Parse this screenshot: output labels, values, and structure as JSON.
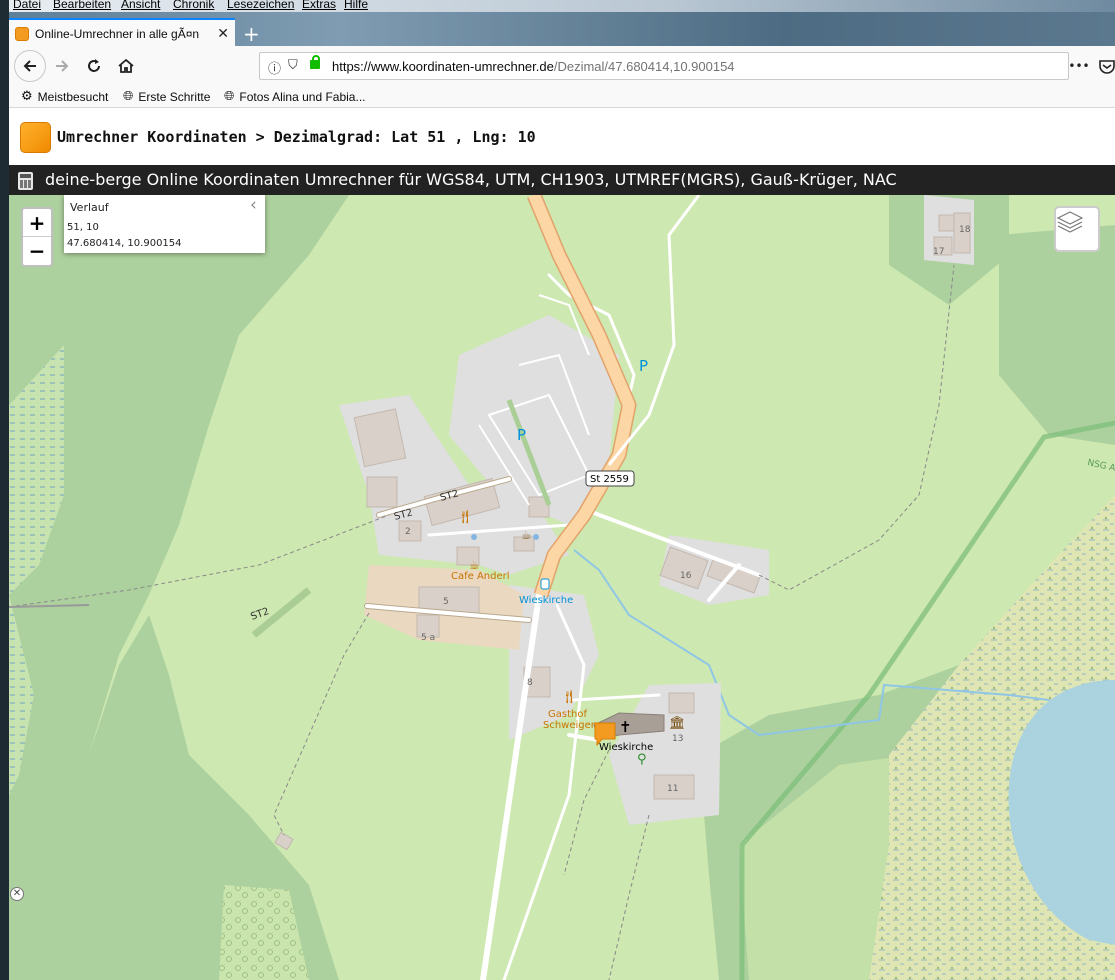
{
  "menu": [
    "Datei",
    "Bearbeiten",
    "Ansicht",
    "Chronik",
    "Lesezeichen",
    "Extras",
    "Hilfe"
  ],
  "tab": {
    "title": "Online-Umrechner in alle gÃ¤n",
    "close": "✕"
  },
  "newtab": "+",
  "nav": {
    "url_domain": "https://www.koordinaten-umrechner.de",
    "url_path": "/Dezimal/47.680414,10.900154",
    "more": "•••"
  },
  "bookmarks": [
    {
      "label": "Meistbesucht",
      "icon": "gear-icon"
    },
    {
      "label": "Erste Schritte",
      "icon": "globe-icon"
    },
    {
      "label": "Fotos Alina und Fabia...",
      "icon": "globe-icon"
    }
  ],
  "page": {
    "heading": "Umrechner Koordinaten > Dezimalgrad: Lat 51 , Lng: 10",
    "banner": "deine-berge Online Koordinaten Umrechner für WGS84, UTM, CH1903, UTMREF(MGRS), Gauß-Krüger, NAC"
  },
  "map": {
    "zoom_in": "+",
    "zoom_out": "−",
    "history": {
      "title": "Verlauf",
      "entries": [
        "51, 10",
        "47.680414, 10.900154"
      ]
    },
    "labels": {
      "road": "St 2559",
      "st2_a": "ST2",
      "st2_b": "ST2",
      "st2_c": "ST2",
      "cafe": "Cafe Anderl",
      "bus": "Wieskirche",
      "gasthof1": "Gasthof",
      "gasthof2": "Schweiger",
      "church": "Wieskirche",
      "nsg": "NSG A",
      "h2": "2",
      "h5": "5",
      "h5a": "5 a",
      "h8": "8",
      "h11": "11",
      "h13": "13",
      "h16": "16",
      "h17": "17",
      "h18": "18",
      "parking": "P"
    },
    "close_x": "✕",
    "colors": {
      "meadow": "#cde8b0",
      "forest": "#add19e",
      "road_major": "#fcd6a4",
      "water": "#aad3df",
      "wetland": "#e6e2b0",
      "building": "#d9d0c9"
    }
  }
}
